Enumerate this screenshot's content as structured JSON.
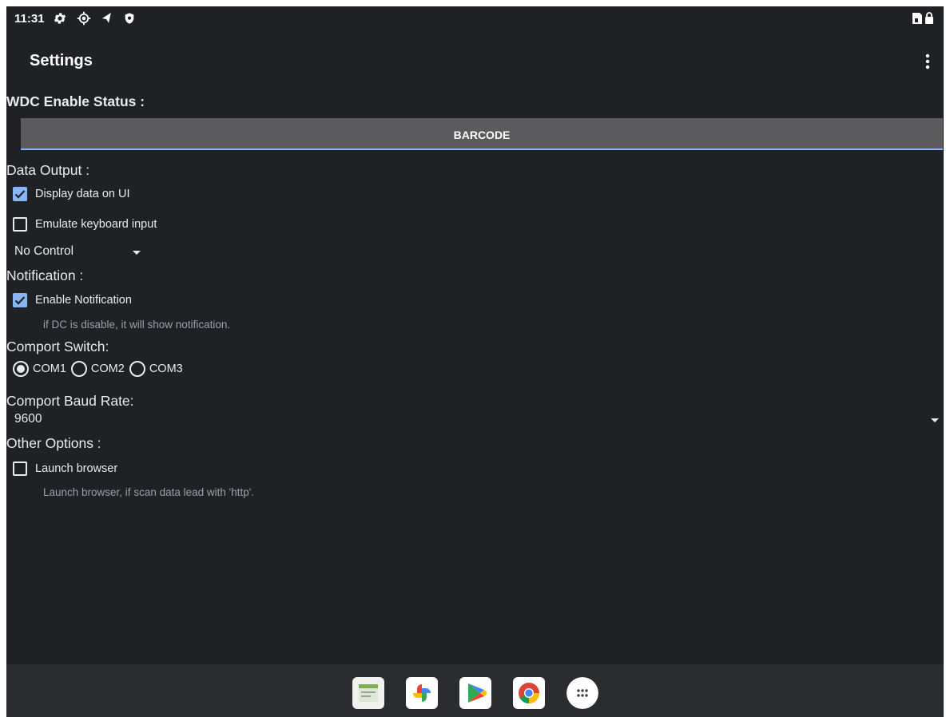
{
  "status_bar": {
    "time": "11:31",
    "icons": [
      "settings-gear-icon",
      "target-icon",
      "location-arrow-icon",
      "shield-icon"
    ],
    "right_icons": [
      "sim-card-icon",
      "battery-lock-icon"
    ]
  },
  "app_bar": {
    "title": "Settings",
    "overflow_icon": "more-vert-icon"
  },
  "wdc": {
    "label": "WDC Enable Status :",
    "button_label": "BARCODE"
  },
  "data_output": {
    "label": "Data Output :",
    "display_on_ui": {
      "label": "Display data on UI",
      "checked": true
    },
    "emulate_keyboard": {
      "label": "Emulate keyboard input",
      "checked": false
    },
    "control_select": {
      "value": "No Control"
    }
  },
  "notification": {
    "label": "Notification :",
    "enable": {
      "label": "Enable Notification",
      "checked": true
    },
    "hint": "if DC is disable, it will show notification."
  },
  "comport_switch": {
    "label": "Comport Switch:",
    "options": [
      "COM1",
      "COM2",
      "COM3"
    ],
    "selected": "COM1"
  },
  "baud_rate": {
    "label": "Comport Baud Rate:",
    "value": "9600"
  },
  "other_options": {
    "label": "Other Options :",
    "launch_browser": {
      "label": "Launch browser",
      "checked": false
    },
    "hint": "Launch browser, if scan data lead with 'http'."
  },
  "dock": {
    "apps": [
      "scanner-app-icon",
      "google-photos-icon",
      "google-play-icon",
      "chrome-icon",
      "app-drawer-icon"
    ]
  },
  "colors": {
    "background": "#202124",
    "accent": "#8ab4f8",
    "button": "#5b5b5e",
    "navbar": "#2b2c2f"
  }
}
